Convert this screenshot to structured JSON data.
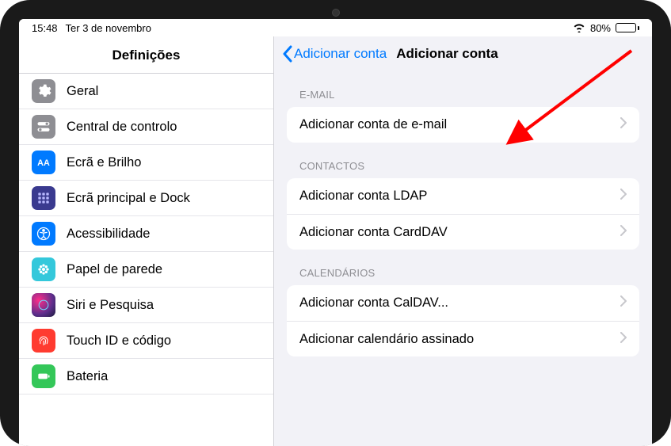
{
  "status": {
    "time": "15:48",
    "date": "Ter 3 de novembro",
    "battery_pct": "80%"
  },
  "sidebar": {
    "title": "Definições",
    "items": [
      {
        "label": "Geral"
      },
      {
        "label": "Central de controlo"
      },
      {
        "label": "Ecrã e Brilho"
      },
      {
        "label": "Ecrã principal e Dock"
      },
      {
        "label": "Acessibilidade"
      },
      {
        "label": "Papel de parede"
      },
      {
        "label": "Siri e Pesquisa"
      },
      {
        "label": "Touch ID e código"
      },
      {
        "label": "Bateria"
      }
    ]
  },
  "detail": {
    "back_label": "Adicionar conta",
    "title": "Adicionar conta",
    "groups": [
      {
        "header": "E-MAIL",
        "rows": [
          {
            "label": "Adicionar conta de e-mail"
          }
        ]
      },
      {
        "header": "CONTACTOS",
        "rows": [
          {
            "label": "Adicionar conta LDAP"
          },
          {
            "label": "Adicionar conta CardDAV"
          }
        ]
      },
      {
        "header": "CALENDÁRIOS",
        "rows": [
          {
            "label": "Adicionar conta CalDAV..."
          },
          {
            "label": "Adicionar calendário assinado"
          }
        ]
      }
    ]
  }
}
